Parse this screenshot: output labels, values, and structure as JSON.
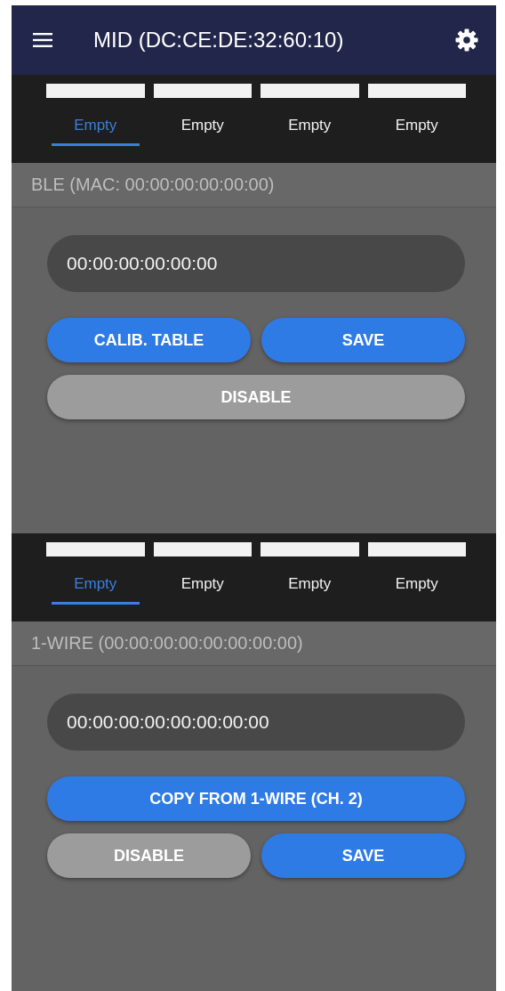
{
  "app_bar": {
    "title": "MID (DC:CE:DE:32:60:10)"
  },
  "sections": [
    {
      "tabs": [
        {
          "label": "Empty",
          "selected": true
        },
        {
          "label": "Empty",
          "selected": false
        },
        {
          "label": "Empty",
          "selected": false
        },
        {
          "label": "Empty",
          "selected": false
        }
      ],
      "header": "BLE (MAC: 00:00:00:00:00:00)",
      "field_value": "00:00:00:00:00:00",
      "button_rows": [
        [
          {
            "label": "CALIB. TABLE",
            "kind": "primary"
          },
          {
            "label": "SAVE",
            "kind": "primary"
          }
        ],
        [
          {
            "label": "DISABLE",
            "kind": "secondary"
          }
        ]
      ]
    },
    {
      "tabs": [
        {
          "label": "Empty",
          "selected": true
        },
        {
          "label": "Empty",
          "selected": false
        },
        {
          "label": "Empty",
          "selected": false
        },
        {
          "label": "Empty",
          "selected": false
        }
      ],
      "header": "1-WIRE (00:00:00:00:00:00:00:00)",
      "field_value": "00:00:00:00:00:00:00:00",
      "button_rows": [
        [
          {
            "label": "COPY FROM 1-WIRE (CH. 2)",
            "kind": "primary"
          }
        ],
        [
          {
            "label": "DISABLE",
            "kind": "secondary"
          },
          {
            "label": "SAVE",
            "kind": "primary"
          }
        ]
      ]
    }
  ]
}
